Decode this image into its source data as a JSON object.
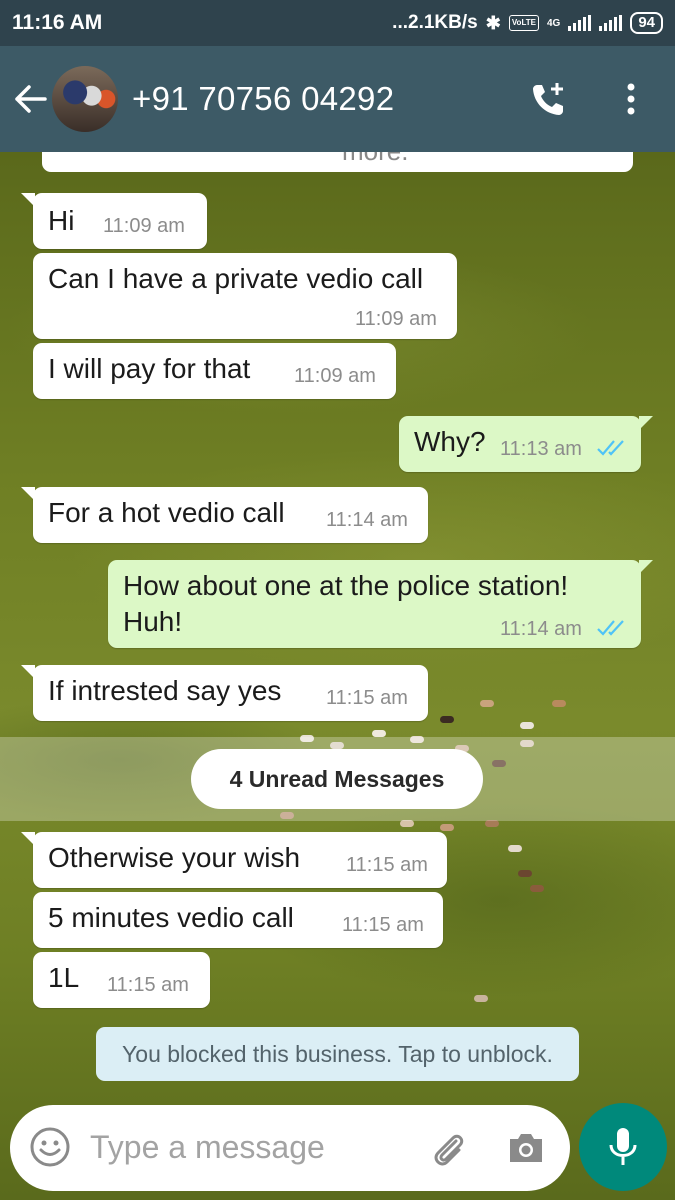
{
  "status_bar": {
    "time": "11:16 AM",
    "network_speed": "...2.1KB/s",
    "volte": "VoLTE",
    "network_type": "4G",
    "battery": "94"
  },
  "header": {
    "contact": "+91 70756 04292",
    "back_icon": "arrow-left-icon",
    "call_icon": "add-call-icon",
    "menu_icon": "more-vert-icon"
  },
  "chat": {
    "partial_text": "more.",
    "messages": [
      {
        "dir": "in",
        "text": "Hi",
        "time": "11:09 am"
      },
      {
        "dir": "in",
        "text": "Can I have a private vedio call",
        "time": "11:09 am"
      },
      {
        "dir": "in",
        "text": "I will pay for that",
        "time": "11:09 am"
      },
      {
        "dir": "out",
        "text": "Why?",
        "time": "11:13 am",
        "status": "read"
      },
      {
        "dir": "in",
        "text": "For a hot vedio call",
        "time": "11:14 am"
      },
      {
        "dir": "out",
        "text": "How about one at the police station!",
        "text2": "Huh!",
        "time": "11:14 am",
        "status": "read"
      },
      {
        "dir": "in",
        "text": "If intrested say yes",
        "time": "11:15 am"
      },
      {
        "dir": "in",
        "text": "Otherwise your wish",
        "time": "11:15 am"
      },
      {
        "dir": "in",
        "text": "5 minutes vedio call",
        "time": "11:15 am"
      },
      {
        "dir": "in",
        "text": "1L",
        "time": "11:15 am"
      }
    ],
    "unread_label": "4 Unread Messages",
    "blocked_notice": "You blocked this business. Tap to unblock."
  },
  "composer": {
    "placeholder": "Type a message",
    "emoji_icon": "emoji-icon",
    "attach_icon": "paperclip-icon",
    "camera_icon": "camera-icon",
    "mic_icon": "mic-icon"
  },
  "colors": {
    "header_bg": "#3d5a66",
    "status_bg": "#2f434d",
    "outgoing_bubble": "#dcf8c6",
    "incoming_bubble": "#ffffff",
    "read_ticks": "#4fc3f7",
    "mic_button": "#00897b"
  }
}
